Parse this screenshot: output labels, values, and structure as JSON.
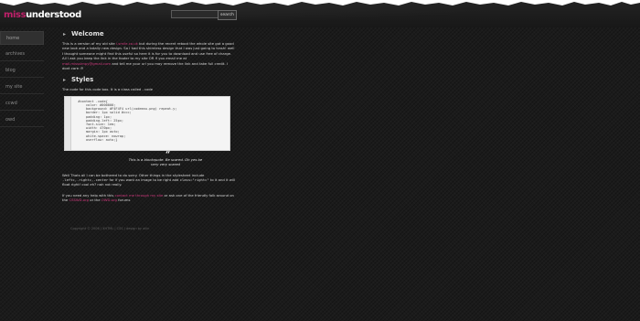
{
  "brand": {
    "part1": "miss",
    "part2": "understood"
  },
  "search": {
    "placeholder": "",
    "button_label": "search"
  },
  "nav": [
    {
      "label": "home"
    },
    {
      "label": "archives"
    },
    {
      "label": "blog"
    },
    {
      "label": "my site"
    },
    {
      "label": "ccwd"
    },
    {
      "label": "owd"
    }
  ],
  "welcome": {
    "heading": "Welcome",
    "p1_before": "This is a version of my old site ",
    "p1_link": "i-smile.co.uk",
    "p1_after": " but during the recent reboot the whole site got a good new look and a totally new design. So I had this shimless design that I was just going to trash! well I thought someone might find this useful so here it is for you to download and use free of charge. All I ask you keep the link in the footer to my site OR if you email me at ",
    "p1_email": "mail.misssimpy@gmail.com",
    "p1_end": " and tell me your url you may remove the link and take full credit. I dont care :P."
  },
  "styles": {
    "heading": "Styles",
    "intro": "The code for this code box. It is a class called ",
    "intro_code": ".code",
    "code": "  #content .code{\n      color: #000000;\n      background: #F4F4F4 url(codemnu.png) repeat-y;\n      border: 1px solid #ccc;\n      padding: 1px;\n      padding-left: 25px;\n      font-size: 1em;\n      width: 470px;\n      margin: 1px auto;\n      white-space: nowrap;\n      overflow: auto;}",
    "blockquote": "This is a blockquote. Be scared. Oh yes be very very scared",
    "p2_before": "Well Thats all I can be bothered to do sorry. Other things in the stylesheet include ",
    "p2_code": ".leftc,.rightc,.center",
    "p2_mid": " for if you want an image to be right add ",
    "p2_code2": "class=\"rightc\"",
    "p2_after": " to it and it will float right! cool eh? nah not really.",
    "p3_before": "If you need any help with this ",
    "p3_link1": "contact me through my site",
    "p3_mid": " or ask one of the friendly folk around on the ",
    "p3_link2": "CSSWD.org",
    "p3_mid2": " or the ",
    "p3_link3": "OWD.org",
    "p3_after": " forums"
  },
  "footer": {
    "text": "Copyright © 2006  |  XHTML  |  CSS  |  design by ailin"
  },
  "colors": {
    "accent": "#c0206a",
    "background": "#1b1b1b"
  }
}
